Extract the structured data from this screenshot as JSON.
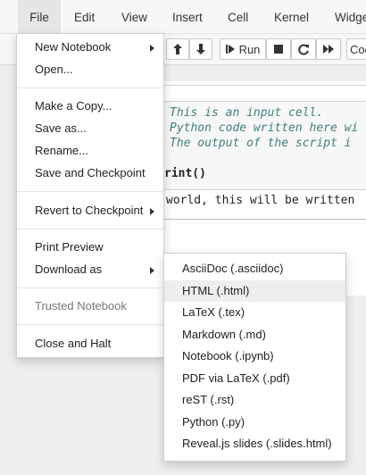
{
  "menubar": {
    "items": [
      "File",
      "Edit",
      "View",
      "Insert",
      "Cell",
      "Kernel",
      "Widge"
    ]
  },
  "toolbar": {
    "run_label": "Run",
    "cell_type_partial": "Cod"
  },
  "code": {
    "comment_lines": [
      "This is an input cell.",
      "Python code written here wi",
      "The output of the script i"
    ],
    "call_line": "rint()",
    "output_line": "world, this will be written"
  },
  "file_menu": {
    "items": [
      {
        "label": "New Notebook",
        "submenu": true
      },
      {
        "label": "Open...",
        "submenu": false
      },
      {
        "label": "Make a Copy...",
        "submenu": false
      },
      {
        "label": "Save as...",
        "submenu": false
      },
      {
        "label": "Rename...",
        "submenu": false
      },
      {
        "label": "Save and Checkpoint",
        "submenu": false
      },
      {
        "label": "Revert to Checkpoint",
        "submenu": true
      },
      {
        "label": "Print Preview",
        "submenu": false
      },
      {
        "label": "Download as",
        "submenu": true
      },
      {
        "label": "Trusted Notebook",
        "submenu": false,
        "disabled": true
      },
      {
        "label": "Close and Halt",
        "submenu": false
      }
    ]
  },
  "download_menu": {
    "items": [
      "AsciiDoc (.asciidoc)",
      "HTML (.html)",
      "LaTeX (.tex)",
      "Markdown (.md)",
      "Notebook (.ipynb)",
      "PDF via LaTeX (.pdf)",
      "reST (.rst)",
      "Python (.py)",
      "Reveal.js slides (.slides.html)"
    ],
    "highlighted_index": 1
  },
  "colors": {
    "comment": "#408080",
    "menu_hover": "#eeeeee"
  }
}
